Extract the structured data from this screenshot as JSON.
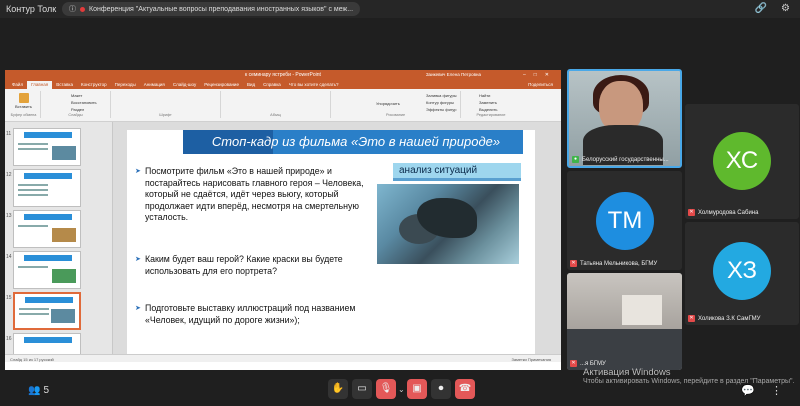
{
  "app": {
    "title": "Контур Толк"
  },
  "conference": {
    "title": "Конференция \"Актуальные вопросы преподавания иностранных языков\" с меж..."
  },
  "powerpoint": {
    "window_title": "к семинару ястреби  -  PowerPoint",
    "user": "Заикевич Елена Петровна",
    "tabs": [
      "Файл",
      "Главная",
      "Вставка",
      "Конструктор",
      "Переходы",
      "Анимация",
      "Слайд-шоу",
      "Рецензирование",
      "Вид",
      "Справка",
      "Что вы хотите сделать?"
    ],
    "share_label": "Поделиться",
    "ribbon_groups": [
      "Буфер обмена",
      "Слайды",
      "Шрифт",
      "Абзац",
      "Рисование",
      "Редактирование"
    ],
    "ribbon_buttons": {
      "paste": "Вставить",
      "cut": "Макет",
      "reset": "Восстановить",
      "section": "Раздел",
      "arrange": "Упорядочить",
      "find": "Найти",
      "replace": "Заменить",
      "select": "Выделить",
      "fill": "Заливка фигуры",
      "outline": "Контур фигуры",
      "effects": "Эффекты фигур",
      "quick": "Экспресс-стили"
    },
    "thumb_numbers": [
      "11",
      "12",
      "13",
      "14",
      "15",
      "16"
    ],
    "status_left": "Слайд 15 из 17    русский",
    "status_right": "Заметки    Примечания"
  },
  "slide": {
    "title": "Стоп-кадр из фильма «Это в нашей природе»",
    "callout": "анализ ситуаций",
    "bullets": [
      "Посмотрите фильм «Это в нашей природе» и постарайтесь нарисовать главного героя – Человека, который не сдаётся, идёт через вьюгу, который продолжает идти вперёд, несмотря на смертельную усталость.",
      "Каким будет ваш герой? Какие краски вы будете использовать для его портрета?",
      "Подготовьте выставку иллюстраций под названием «Человек, идущий по дороге жизни»);"
    ]
  },
  "participants": {
    "tiles": [
      {
        "name": "Белорусский государственны...",
        "muted": false
      },
      {
        "initials": "ХС",
        "name": "Холмуродова Сабина",
        "color": "#5fb92d",
        "muted": true
      },
      {
        "initials": "ТМ",
        "name": "Татьяна Мельникова, БГМУ",
        "color": "#1e8ee0",
        "muted": true
      },
      {
        "initials": "ХЗ",
        "name": "Холикова З.К СамГМУ",
        "color": "#23a9e1",
        "muted": true
      },
      {
        "name": "...я БГМУ",
        "muted": true
      }
    ],
    "count": "5"
  },
  "windows_watermark": {
    "line1": "Активация Windows",
    "line2": "Чтобы активировать Windows, перейдите в раздел \"Параметры\"."
  }
}
